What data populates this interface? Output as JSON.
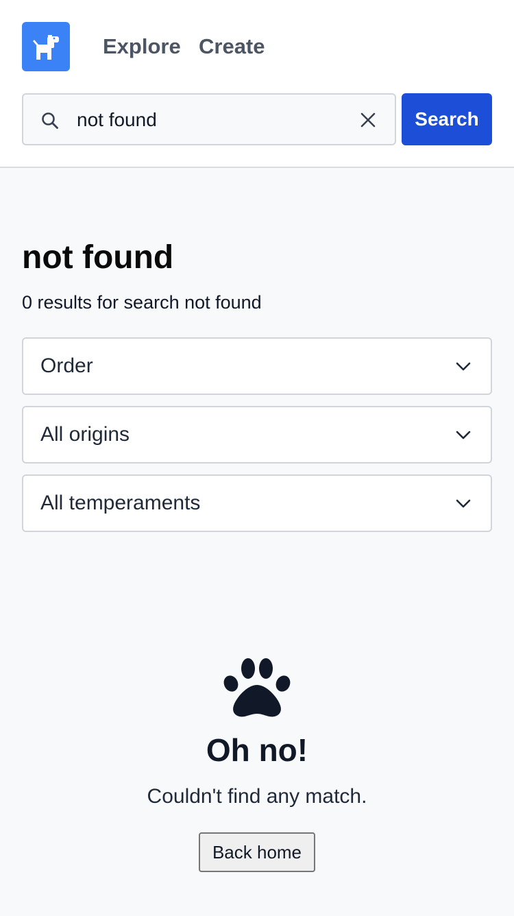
{
  "header": {
    "logo_icon": "dog-icon",
    "nav": {
      "explore": "Explore",
      "create": "Create"
    },
    "search": {
      "value": "not found",
      "placeholder": "",
      "button_label": "Search"
    }
  },
  "main": {
    "title": "not found",
    "summary": "0 results for search not found",
    "filters": {
      "order": "Order",
      "origins": "All origins",
      "temperaments": "All temperaments"
    }
  },
  "empty_state": {
    "icon": "paw-icon",
    "title": "Oh no!",
    "message": "Couldn't find any match.",
    "button_label": "Back home"
  },
  "colors": {
    "brand": "#3b82f6",
    "primary_button": "#1d4ed8",
    "background": "#f8f9fb"
  }
}
